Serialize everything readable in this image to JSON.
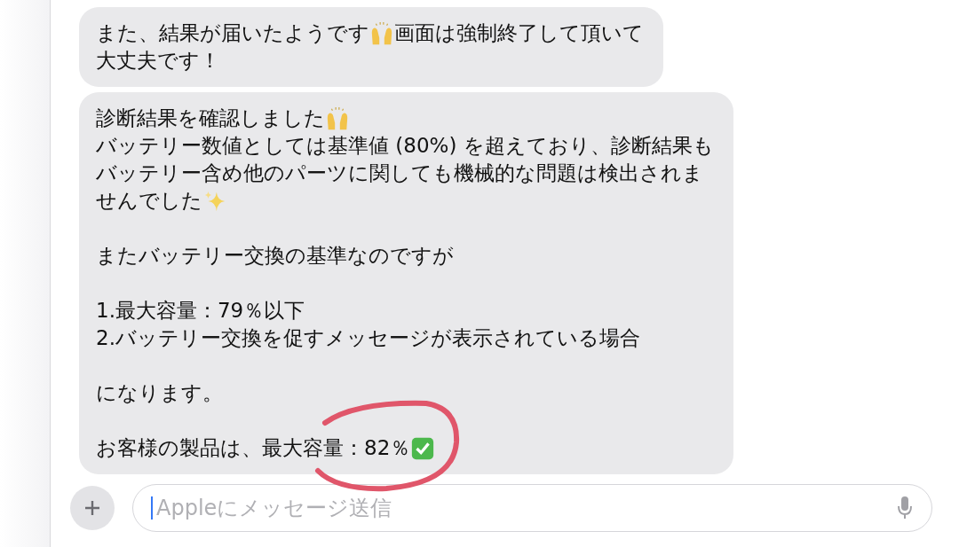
{
  "messages": [
    {
      "paragraphs": [
        [
          [
            {
              "kind": "text",
              "text": "また、結果が届いたようです"
            },
            {
              "kind": "hands"
            },
            {
              "kind": "text",
              "text": "画面は強制終了して頂いて"
            }
          ],
          [
            {
              "kind": "text",
              "text": "大丈夫です！"
            }
          ]
        ]
      ]
    },
    {
      "paragraphs": [
        [
          [
            {
              "kind": "text",
              "text": "診断結果を確認しました"
            },
            {
              "kind": "hands"
            }
          ],
          [
            {
              "kind": "text",
              "text": "バッテリー数値としては基準値 (80%) を超えており、診断結果も"
            }
          ],
          [
            {
              "kind": "text",
              "text": "バッテリー含め他のパーツに関しても機械的な問題は検出されま"
            }
          ],
          [
            {
              "kind": "text",
              "text": "せんでした"
            },
            {
              "kind": "sparkles"
            }
          ]
        ],
        [
          [
            {
              "kind": "text",
              "text": "またバッテリー交換の基準なのですが"
            }
          ]
        ],
        [
          [
            {
              "kind": "text",
              "text": "1.最大容量：79％以下"
            }
          ],
          [
            {
              "kind": "text",
              "text": "2.バッテリー交換を促すメッセージが表示されている場合"
            }
          ]
        ],
        [
          [
            {
              "kind": "text",
              "text": "になります。"
            }
          ]
        ],
        [
          [
            {
              "kind": "text",
              "text": "お客様の製品は、最大容量：82％"
            },
            {
              "kind": "check"
            }
          ]
        ]
      ],
      "circled": true
    }
  ],
  "composer": {
    "placeholder": "Appleにメッセージ送信"
  }
}
